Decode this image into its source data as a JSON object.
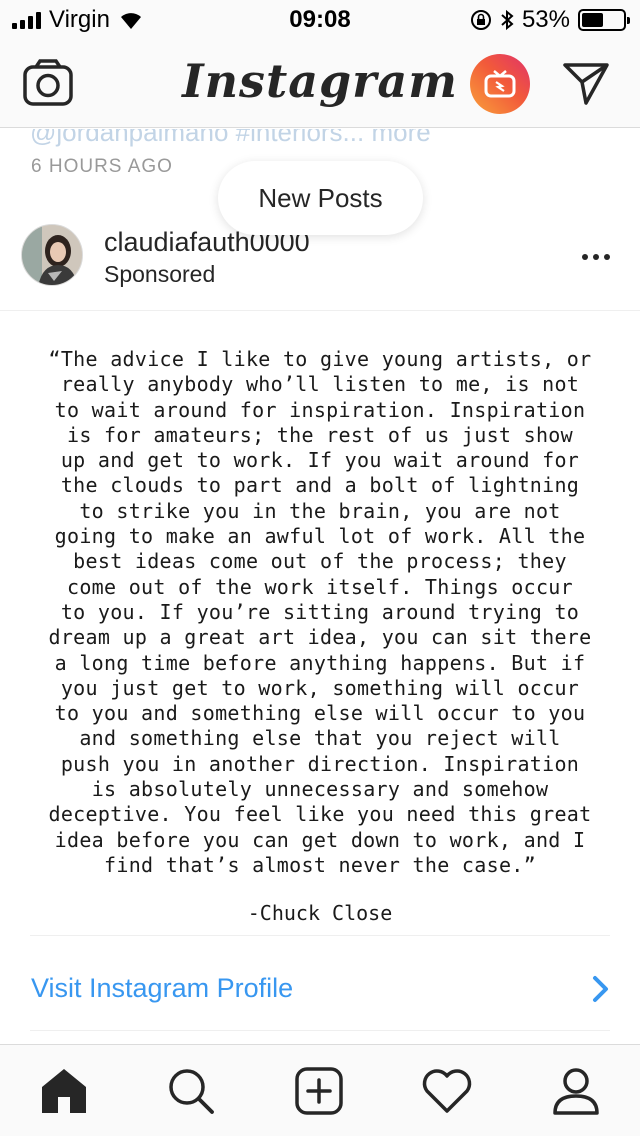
{
  "status_bar": {
    "carrier": "Virgin",
    "time": "09:08",
    "battery_percent": "53%",
    "battery_level": 0.53,
    "icons": [
      "signal-icon",
      "wifi-icon",
      "orientation-lock-icon",
      "bluetooth-icon",
      "battery-icon"
    ]
  },
  "nav": {
    "logo": "Instagram",
    "icons": [
      "camera-icon",
      "igtv-icon",
      "direct-message-icon"
    ]
  },
  "feed": {
    "previous_caption": "@jordanpalmano #interiors... more",
    "timestamp": "6 HOURS AGO",
    "new_posts_label": "New Posts",
    "post": {
      "username": "claudiafauth0000",
      "sponsored_label": "Sponsored",
      "quote": "“The advice I like to give young artists, or\nreally anybody who’ll listen to me, is not\nto wait around for inspiration. Inspiration\nis for amateurs; the rest of us just show\nup and get to work. If you wait around for\nthe clouds to part and a bolt of lightning\nto strike you in the brain, you are not\ngoing to make an awful lot of work. All the\nbest ideas come out of the process; they\ncome out of the work itself. Things occur\nto you. If you’re sitting around trying to\ndream up a great art idea, you can sit there\na long time before anything happens. But if\nyou just get to work, something will occur\nto you and something else will occur to you\nand something else that you reject will\npush you in another direction. Inspiration\nis absolutely unnecessary and somehow\ndeceptive. You feel like you need this great\nidea before you can get down to work, and I\nfind that’s almost never the case.”",
      "attribution": "-Chuck Close",
      "cta_label": "Visit Instagram Profile"
    }
  },
  "tab_bar": {
    "tabs": [
      "home-icon",
      "search-icon",
      "new-post-icon",
      "activity-heart-icon",
      "profile-icon"
    ]
  },
  "colors": {
    "link_blue": "#3897f0",
    "text": "#262626",
    "muted": "#999999",
    "bar_bg": "#fafafa"
  }
}
